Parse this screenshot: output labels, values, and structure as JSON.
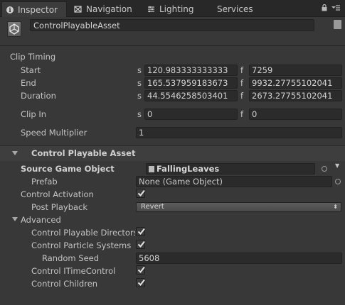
{
  "tabs": [
    {
      "label": "Inspector",
      "icon": "info-icon",
      "active": true
    },
    {
      "label": "Navigation",
      "icon": "navigation-icon",
      "active": false
    },
    {
      "label": "Lighting",
      "icon": "lighting-icon",
      "active": false
    },
    {
      "label": "Services",
      "icon": "",
      "active": false
    }
  ],
  "header": {
    "object_name": "ControlPlayableAsset"
  },
  "clip_timing": {
    "title": "Clip Timing",
    "start": {
      "label": "Start",
      "seconds": "120.983333333333",
      "frames": "7259"
    },
    "end": {
      "label": "End",
      "seconds": "165.537959183673",
      "frames": "9932.27755102041"
    },
    "duration": {
      "label": "Duration",
      "seconds": "44.5546258503401",
      "frames": "2673.27755102041"
    },
    "clip_in": {
      "label": "Clip In",
      "seconds": "0",
      "frames": "0"
    },
    "speed": {
      "label": "Speed Multiplier",
      "value": "1"
    },
    "unit_s": "s",
    "unit_f": "f"
  },
  "control_asset": {
    "title": "Control Playable Asset",
    "source_label": "Source Game Object",
    "source_value": "FallingLeaves",
    "prefab_label": "Prefab",
    "prefab_value": "None (Game Object)",
    "activation_label": "Control Activation",
    "activation_checked": true,
    "post_playback_label": "Post Playback",
    "post_playback_value": "Revert",
    "advanced_label": "Advanced",
    "directors_label": "Control Playable Directors",
    "directors_checked": true,
    "particles_label": "Control Particle Systems",
    "particles_checked": true,
    "seed_label": "Random Seed",
    "seed_value": "5608",
    "itime_label": "Control ITimeControl",
    "itime_checked": true,
    "children_label": "Control Children",
    "children_checked": true
  }
}
